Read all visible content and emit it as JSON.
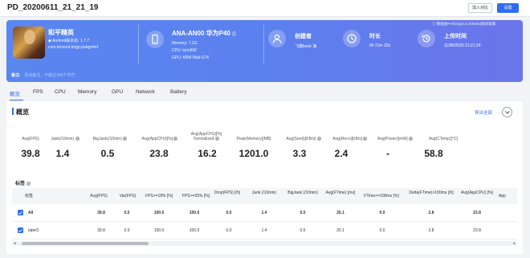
{
  "header": {
    "title": "PD_20200611_21_21_19",
    "btn_compare": "加入对比",
    "btn_settings": "设置"
  },
  "banner": {
    "app": {
      "name": "和平精英",
      "version": "Android版本名: 1.7.7",
      "package": "com.tencent.tmgp.pubgmhd"
    },
    "note_label": "备注:",
    "note_placeholder": "添加备注，不超过200个字符",
    "device": {
      "title": "ANA-AN00 华为P40",
      "memory": "Memory: 7.2G",
      "cpu": "CPU: kirin990",
      "gpu": "GPU: ARM Mali-G76"
    },
    "creator": {
      "label": "创建者",
      "value": "飞旋book 海"
    },
    "duration": {
      "label": "时长",
      "value": "0h 21m 33s"
    },
    "upload": {
      "label": "上传时间",
      "value": "11/06/2020 21:21:24"
    },
    "tip": "数据由PerfDog(3.5.200402)版本收集"
  },
  "tabs": [
    "概览",
    "FPS",
    "CPU",
    "Memory",
    "GPU",
    "Network",
    "Battery"
  ],
  "overview": {
    "title": "概览",
    "export": "导出全部",
    "metrics": [
      {
        "label": "Avg(FPS)",
        "value": "39.8"
      },
      {
        "label": "Jank(/10min)",
        "value": "1.4"
      },
      {
        "label": "BigJank(/10min)",
        "value": "0.5"
      },
      {
        "label": "Avg(AppCPU)[%]",
        "value": "23.8"
      },
      {
        "label": "Avg(AppCPU)[%] Normalized",
        "value": "16.2"
      },
      {
        "label": "Peak(Memory)[MB]",
        "value": "1201.0"
      },
      {
        "label": "Avg(Send)[KB/s]",
        "value": "3.3"
      },
      {
        "label": "Avg(Recv)[KB/s]",
        "value": "2.4"
      },
      {
        "label": "Avg(Power)[mW]",
        "value": "-"
      },
      {
        "label": "Avg(CTemp)[°C]",
        "value": "58.8"
      }
    ]
  },
  "tags": {
    "title": "标签",
    "columns": [
      "标签",
      "Avg(FPS)",
      "Var(FPS)",
      "FPS>=18% [%]",
      "FPS>=25% [%]",
      "Drop(FPS) [/h]",
      "Jank (/10min)",
      "BigJank (/10min)",
      "Avg(FTime) [ms]",
      "FTime>=100ms [%]",
      "Delta(FTime)>100ms [/h]",
      "Avg(AppCPU) [%]",
      "App"
    ],
    "rows": [
      {
        "name": "All",
        "cells": [
          "39.8",
          "0.5",
          "100.0",
          "100.0",
          "0.0",
          "1.4",
          "0.5",
          "25.1",
          "0.0",
          "2.8",
          "23.8"
        ]
      },
      {
        "name": "label1",
        "cells": [
          "39.8",
          "0.5",
          "100.0",
          "100.0",
          "0.0",
          "1.4",
          "0.5",
          "25.1",
          "0.0",
          "2.8",
          "23.8"
        ]
      }
    ]
  }
}
